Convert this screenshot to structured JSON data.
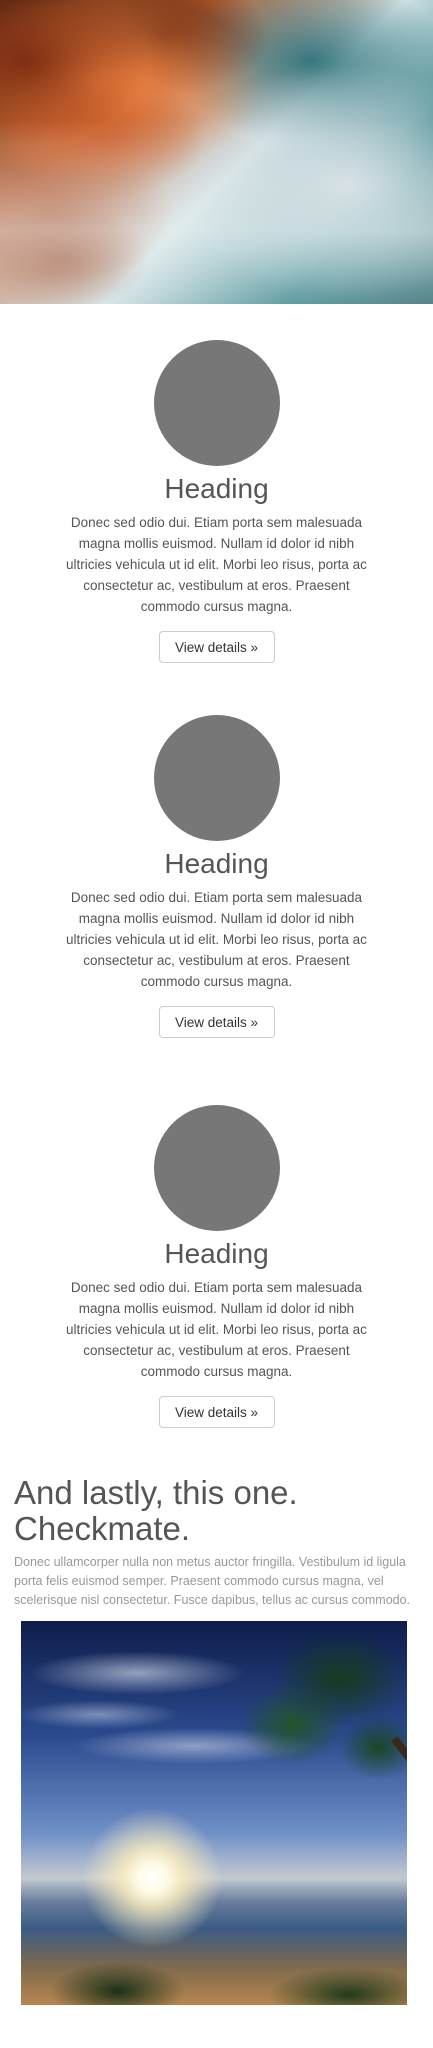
{
  "hero": {
    "image_description": "coastal rocks with misty sea"
  },
  "features": [
    {
      "heading": "Heading",
      "text": "Donec sed odio dui. Etiam porta sem malesuada magna mollis euismod. Nullam id dolor id nibh ultricies vehicula ut id elit. Morbi leo risus, porta ac consectetur ac, vestibulum at eros. Praesent commodo cursus magna.",
      "button": "View details »"
    },
    {
      "heading": "Heading",
      "text": "Donec sed odio dui. Etiam porta sem malesuada magna mollis euismod. Nullam id dolor id nibh ultricies vehicula ut id elit. Morbi leo risus, porta ac consectetur ac, vestibulum at eros. Praesent commodo cursus magna.",
      "button": "View details »"
    },
    {
      "heading": "Heading",
      "text": "Donec sed odio dui. Etiam porta sem malesuada magna mollis euismod. Nullam id dolor id nibh ultricies vehicula ut id elit. Morbi leo risus, porta ac consectetur ac, vestibulum at eros. Praesent commodo cursus magna.",
      "button": "View details »"
    }
  ],
  "closing": {
    "heading": "And lastly, this one. Checkmate.",
    "text": "Donec ullamcorper nulla non metus auctor fringilla. Vestibulum id ligula porta felis euismod semper. Praesent commodo cursus magna, vel scelerisque nisl consectetur. Fusce dapibus, tellus ac cursus commodo."
  },
  "colors": {
    "placeholder_circle": "#777777",
    "text": "#555555",
    "muted_text": "#999999",
    "button_border": "#cccccc"
  }
}
